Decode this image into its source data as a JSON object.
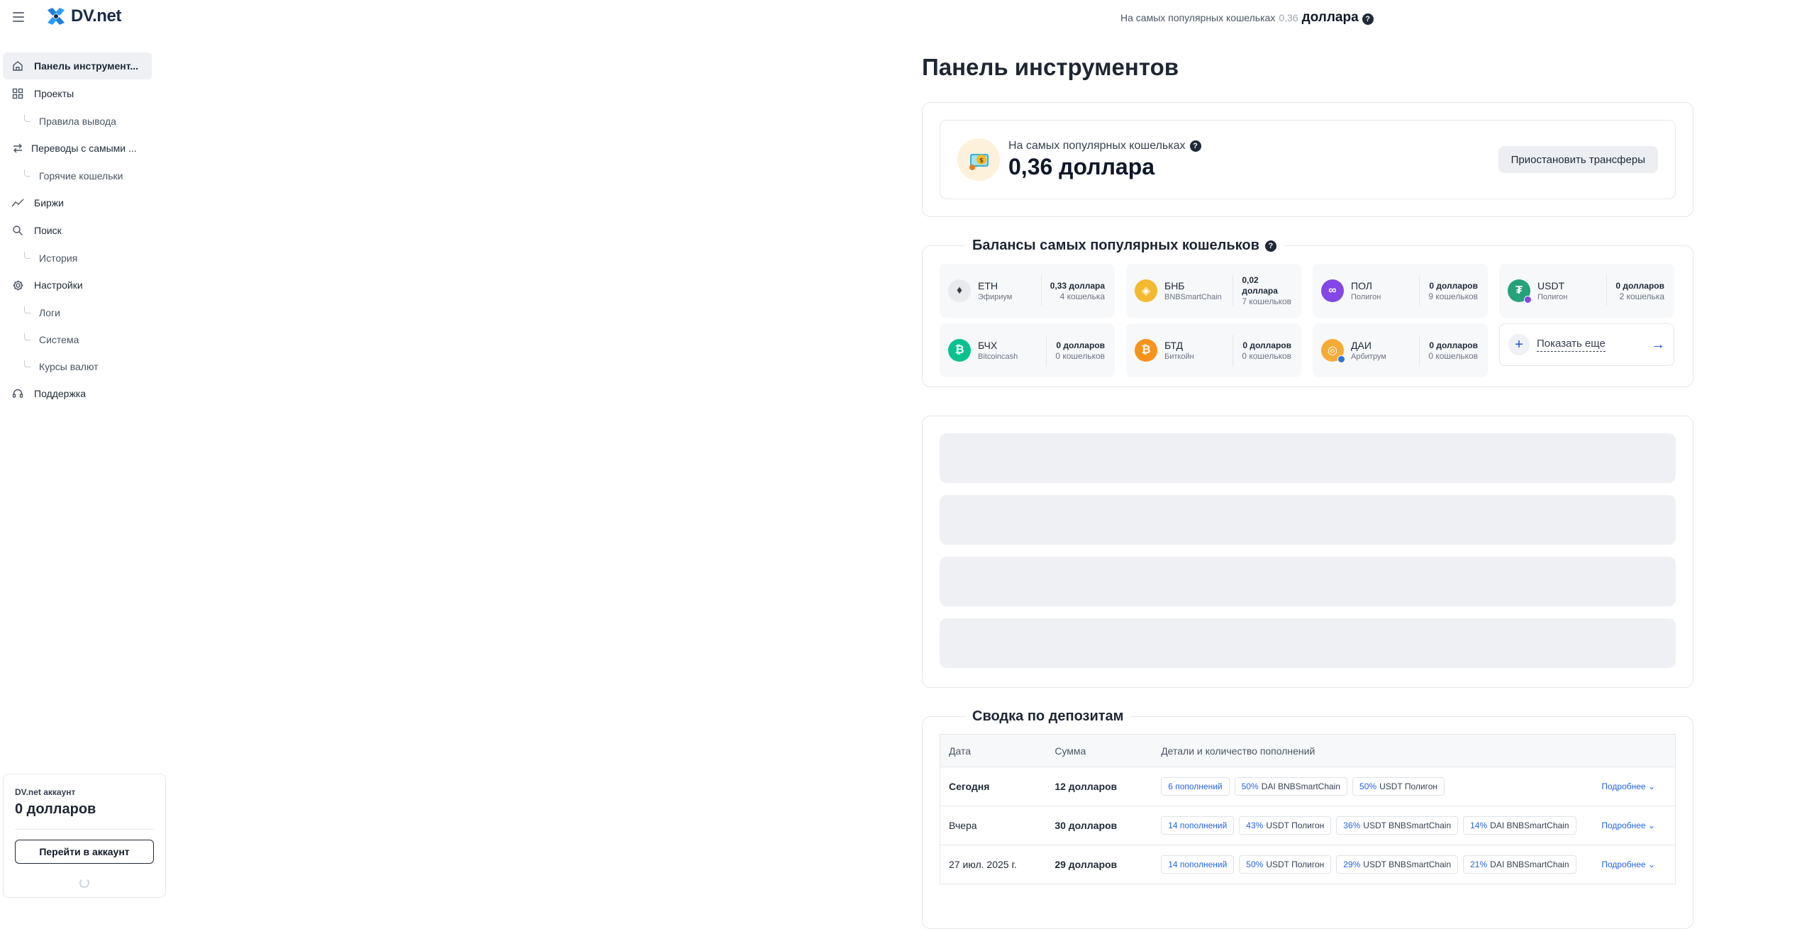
{
  "header": {
    "logo_text": "DV.net",
    "hot_label": "На самых популярных кошельках",
    "hot_number": "0,36",
    "hot_unit": "доллара",
    "help": "?"
  },
  "sidebar": {
    "items": [
      {
        "label": "Панель инструмент..."
      },
      {
        "label": "Проекты"
      },
      {
        "label": "Правила вывода"
      },
      {
        "label": "Переводы с самыми ..."
      },
      {
        "label": "Горячие кошельки"
      },
      {
        "label": "Биржи"
      },
      {
        "label": "Поиск"
      },
      {
        "label": "История"
      },
      {
        "label": "Настройки"
      },
      {
        "label": "Логи"
      },
      {
        "label": "Система"
      },
      {
        "label": "Курсы валют"
      },
      {
        "label": "Поддержка"
      }
    ]
  },
  "account": {
    "label": "DV.net аккаунт",
    "value": "0 долларов",
    "button": "Перейти в аккаунт"
  },
  "main": {
    "title": "Панель инструментов",
    "hot_card": {
      "label": "На самых популярных кошельках",
      "value": "0,36 доллара",
      "pause_button": "Приостановить трансферы"
    },
    "balances": {
      "title": "Балансы самых популярных кошельков",
      "coins": [
        {
          "symbol": "ETH",
          "network": "Эфириум",
          "amount": "0,33 доллара",
          "wallets": "4 кошелька",
          "color": "#e8eaee",
          "glyph": "♦",
          "badge": ""
        },
        {
          "symbol": "БНБ",
          "network": "BNBSmartChain",
          "amount": "0,02 доллара",
          "wallets": "7 кошельков",
          "color": "#f3ba2f",
          "glyph": "◈",
          "badge": ""
        },
        {
          "symbol": "ПОЛ",
          "network": "Полигон",
          "amount": "0 долларов",
          "wallets": "9 кошельков",
          "color": "#8247e5",
          "glyph": "∞",
          "badge": ""
        },
        {
          "symbol": "USDT",
          "network": "Полигон",
          "amount": "0 долларов",
          "wallets": "2 кошелька",
          "color": "#26a17b",
          "glyph": "₮",
          "badge": "#8247e5"
        },
        {
          "symbol": "БЧХ",
          "network": "Bitcoincash",
          "amount": "0 долларов",
          "wallets": "0 кошельков",
          "color": "#0ac18e",
          "glyph": "₿",
          "badge": ""
        },
        {
          "symbol": "БТД",
          "network": "Биткойн",
          "amount": "0 долларов",
          "wallets": "0 кошельков",
          "color": "#f7931a",
          "glyph": "₿",
          "badge": ""
        },
        {
          "symbol": "ДАИ",
          "network": "Арбитрум",
          "amount": "0 долларов",
          "wallets": "0 кошельков",
          "color": "#f5ac37",
          "glyph": "◎",
          "badge": "#2d74da"
        }
      ],
      "show_more": "Показать еще"
    },
    "deposits": {
      "title": "Сводка по депозитам",
      "columns": [
        "Дата",
        "Сумма",
        "Детали и количество пополнений"
      ],
      "details_label": "Подробнее",
      "rows": [
        {
          "date": "Сегодня",
          "sum": "12 долларов",
          "count": "6 пополнений",
          "chips": [
            {
              "pct": "50%",
              "label": "DAI BNBSmartChain"
            },
            {
              "pct": "50%",
              "label": "USDT Полигон"
            }
          ]
        },
        {
          "date": "Вчера",
          "sum": "30 долларов",
          "count": "14 пополнений",
          "chips": [
            {
              "pct": "43%",
              "label": "USDT Полигон"
            },
            {
              "pct": "36%",
              "label": "USDT BNBSmartChain"
            },
            {
              "pct": "14%",
              "label": "DAI BNBSmartChain"
            }
          ]
        },
        {
          "date": "27 июл. 2025 г.",
          "sum": "29 долларов",
          "count": "14 пополнений",
          "chips": [
            {
              "pct": "50%",
              "label": "USDT Полигон"
            },
            {
              "pct": "29%",
              "label": "USDT BNBSmartChain"
            },
            {
              "pct": "21%",
              "label": "DAI BNBSmartChain"
            }
          ]
        }
      ]
    }
  }
}
